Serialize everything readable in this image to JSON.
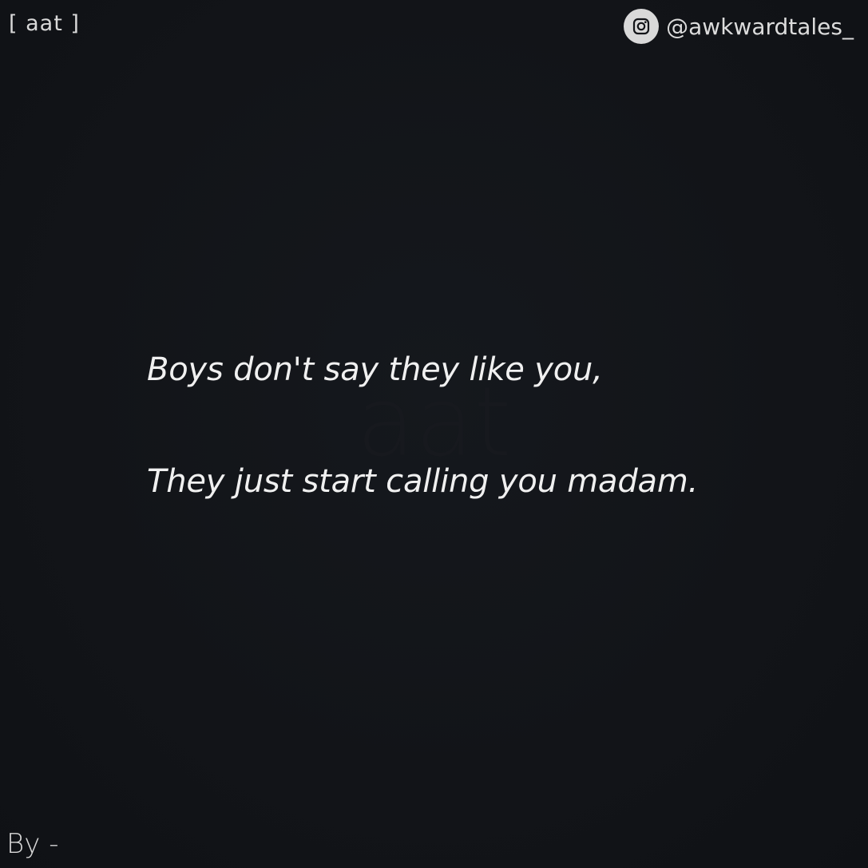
{
  "header": {
    "brand_tag": "[ aat ]",
    "handle": "@awkwardtales_",
    "handle_icon": "instagram-icon"
  },
  "watermark": {
    "text": "aat"
  },
  "quote": {
    "line1": "Boys don't say they like you,",
    "line2": "They just start calling you madam."
  },
  "footer": {
    "byline": "By -"
  },
  "colors": {
    "background": "#121418",
    "text": "#f0f0f0",
    "badge": "#d9d9d9"
  }
}
